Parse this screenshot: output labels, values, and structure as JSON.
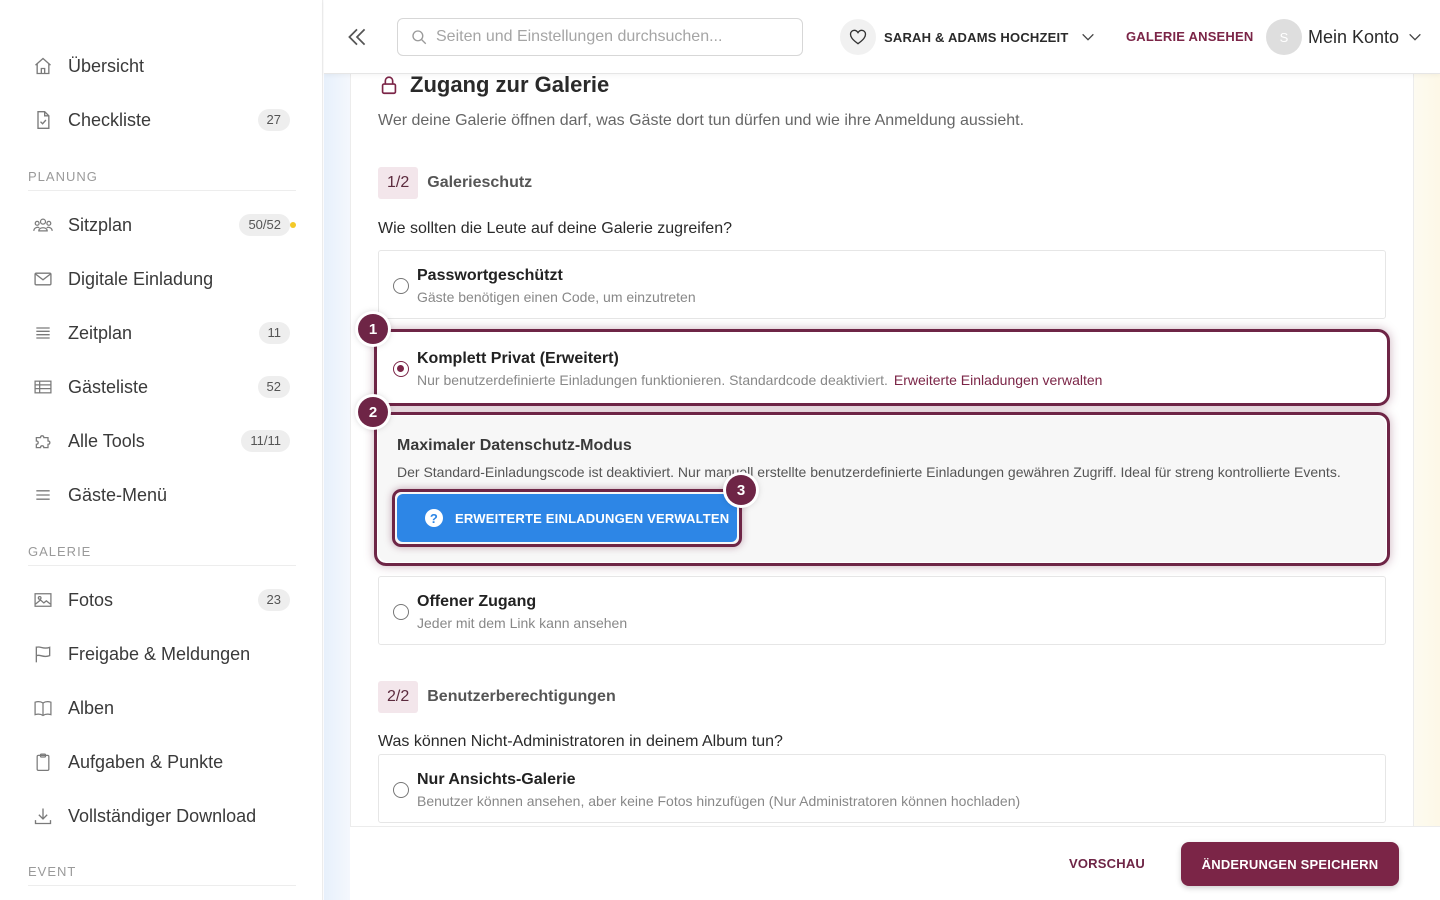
{
  "sidebar": {
    "items_top": [
      {
        "label": "Übersicht",
        "icon": "home-icon"
      },
      {
        "label": "Checkliste",
        "icon": "document-check-icon",
        "badge": "27"
      }
    ],
    "section_planung": "PLANUNG",
    "items_planung": [
      {
        "label": "Sitzplan",
        "icon": "people-icon",
        "badge": "50/52"
      },
      {
        "label": "Digitale Einladung",
        "icon": "mail-icon"
      },
      {
        "label": "Zeitplan",
        "icon": "list-icon",
        "badge": "11"
      },
      {
        "label": "Gästeliste",
        "icon": "table-icon",
        "badge": "52"
      },
      {
        "label": "Alle Tools",
        "icon": "puzzle-icon",
        "badge": "11/11"
      },
      {
        "label": "Gäste-Menü",
        "icon": "menu-icon"
      }
    ],
    "section_galerie": "GALERIE",
    "items_galerie": [
      {
        "label": "Fotos",
        "icon": "image-icon",
        "badge": "23"
      },
      {
        "label": "Freigabe & Meldungen",
        "icon": "flag-icon"
      },
      {
        "label": "Alben",
        "icon": "book-icon"
      },
      {
        "label": "Aufgaben & Punkte",
        "icon": "clipboard-icon"
      },
      {
        "label": "Vollständiger Download",
        "icon": "download-icon"
      }
    ],
    "section_event": "EVENT"
  },
  "topbar": {
    "search_placeholder": "Seiten und Einstellungen durchsuchen...",
    "event_name": "SARAH & ADAMS HOCHZEIT",
    "gallery_link": "GALERIE ANSEHEN",
    "avatar_letter": "S",
    "account_label": "Mein Konto"
  },
  "content": {
    "title": "Zugang zur Galerie",
    "description": "Wer deine Galerie öffnen darf, was Gäste dort tun dürfen und wie ihre Anmeldung aussieht.",
    "step1": {
      "num": "1/2",
      "title": "Galerieschutz"
    },
    "question1": "Wie sollten die Leute auf deine Galerie zugreifen?",
    "options": [
      {
        "title": "Passwortgeschützt",
        "sub": "Gäste benötigen einen Code, um einzutreten",
        "checked": false
      },
      {
        "title": "Komplett Privat (Erweitert)",
        "sub": "Nur benutzerdefinierte Einladungen funktionieren. Standardcode deaktiviert.",
        "link": "Erweiterte Einladungen verwalten",
        "checked": true
      },
      {
        "title": "Offener Zugang",
        "sub": "Jeder mit dem Link kann ansehen",
        "checked": false
      }
    ],
    "privacy": {
      "title": "Maximaler Datenschutz-Modus",
      "desc": "Der Standard-Einladungscode ist deaktiviert. Nur manuell erstellte benutzerdefinierte Einladungen gewähren Zugriff. Ideal für streng kontrollierte Events.",
      "button": "ERWEITERTE EINLADUNGEN VERWALTEN"
    },
    "step2": {
      "num": "2/2",
      "title": "Benutzerberechtigungen"
    },
    "question2": "Was können Nicht-Administratoren in deinem Album tun?",
    "option_perm": {
      "title": "Nur Ansichts-Galerie",
      "sub": "Benutzer können ansehen, aber keine Fotos hinzufügen (Nur Administratoren können hochladen)"
    },
    "markers": [
      "1",
      "2",
      "3"
    ]
  },
  "footer": {
    "preview": "VORSCHAU",
    "save": "ÄNDERUNGEN SPEICHERN"
  },
  "colors": {
    "accent": "#7b2547",
    "button_blue": "#2d86e6",
    "badge_dot": "#f3c928"
  }
}
